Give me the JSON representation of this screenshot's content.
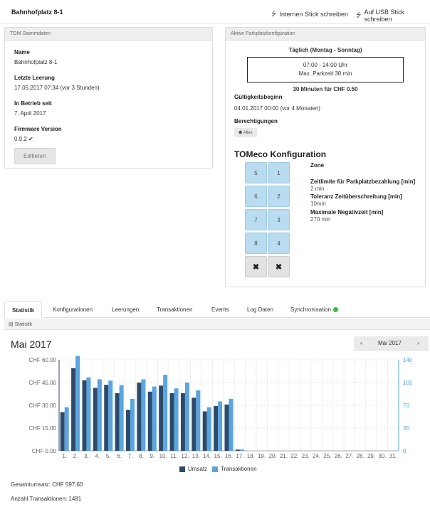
{
  "header": {
    "title": "Bahnhofplatz 8-1",
    "write_internal": "Internen Stick schreiben",
    "write_usb": "Auf USB Stick schreiben",
    "usb_icon": "usb-icon"
  },
  "stammdaten": {
    "heading": "TOM Stammdaten",
    "name_label": "Name",
    "name_value": "Bahnhofplatz 8-1",
    "leerung_label": "Letzte Leerung",
    "leerung_value": "17.05.2017 07:34 (vor 3 Stunden)",
    "betrieb_label": "In Betrieb seit",
    "betrieb_value": "7. April 2017",
    "firmware_label": "Firmware Version",
    "firmware_value": "0.9.2",
    "firmware_status_icon": "check-icon",
    "edit_button": "Editieren"
  },
  "parkplatz": {
    "heading": "Aktive Parkplatzkonfiguration",
    "days": "Täglich (Montag - Sonntag)",
    "hours": "07:00 - 24:00 Uhr",
    "max": "Max. Parkzeit 30 min",
    "rate": "30 Minuten für CHF 0.50",
    "validity_label": "Gültigkeitsbeginn",
    "validity_value": "04.01.2017 00:00 (vor 4 Monaten)",
    "rights_label": "Berechtigungen",
    "rights_tag": "Alles"
  },
  "tomeco": {
    "title": "TOMeco Konfiguration",
    "buttons": [
      "5",
      "1",
      "6",
      "2",
      "7",
      "3",
      "8",
      "4",
      "✖",
      "✖"
    ],
    "zone_label": "Zone",
    "limit_label": "Zeitlimite für Parkplatzbezahlung [min]",
    "limit_value": "2 min",
    "tolerance_label": "Toleranz Zeitüberschreitung [min]",
    "tolerance_value": "10min",
    "negative_label": "Maximale Negativzeit [min]",
    "negative_value": "270 min"
  },
  "tabs": [
    "Statistik",
    "Konfigurationen",
    "Leerungen",
    "Transaktionen",
    "Events",
    "Log Daten",
    "Synchronisation"
  ],
  "sync_status_color": "#3cb83c",
  "stats": {
    "subheading": "Statistik",
    "month_title": "Mai 2017",
    "nav_label": "Mai 2017",
    "prev": "‹",
    "next": "›",
    "total": "Gesamtumsatz: CHF 597.60",
    "count": "Anzahl Transaktionen: 1481"
  },
  "chart_data": {
    "type": "bar",
    "categories": [
      "1.",
      "2.",
      "3.",
      "4.",
      "5.",
      "6.",
      "7.",
      "8.",
      "9.",
      "10.",
      "11.",
      "12.",
      "13.",
      "14.",
      "15.",
      "16.",
      "17.",
      "18.",
      "19.",
      "20.",
      "21.",
      "22.",
      "23.",
      "24.",
      "25.",
      "26.",
      "27.",
      "28.",
      "29.",
      "30.",
      "31."
    ],
    "series": [
      {
        "name": "Umsatz",
        "axis": "left",
        "color": "#2e4a6b",
        "values": [
          25.5,
          54.5,
          46.5,
          41.5,
          43.5,
          38,
          27,
          45,
          39,
          43,
          38,
          38,
          35,
          26,
          29.5,
          30.5,
          0.8,
          0,
          0,
          0,
          0,
          0,
          0,
          0,
          0,
          0,
          0,
          0,
          0,
          0,
          0
        ]
      },
      {
        "name": "Transaktionen",
        "axis": "right",
        "color": "#5aa5e0",
        "values": [
          67,
          146,
          113,
          110,
          108,
          101,
          80,
          110,
          99,
          117,
          96,
          105,
          93,
          67,
          76,
          80,
          2,
          0,
          0,
          0,
          0,
          0,
          0,
          0,
          0,
          0,
          0,
          0,
          0,
          0,
          0
        ]
      }
    ],
    "y_left": {
      "ticks": [
        "CHF 0.00",
        "CHF 15.00",
        "CHF 30.00",
        "CHF 45.00",
        "CHF 60.00"
      ],
      "range": [
        0,
        60
      ]
    },
    "y_right": {
      "ticks": [
        "0",
        "35",
        "70",
        "105",
        "140"
      ],
      "range": [
        0,
        140
      ]
    },
    "grid": true,
    "legend": "bottom"
  }
}
